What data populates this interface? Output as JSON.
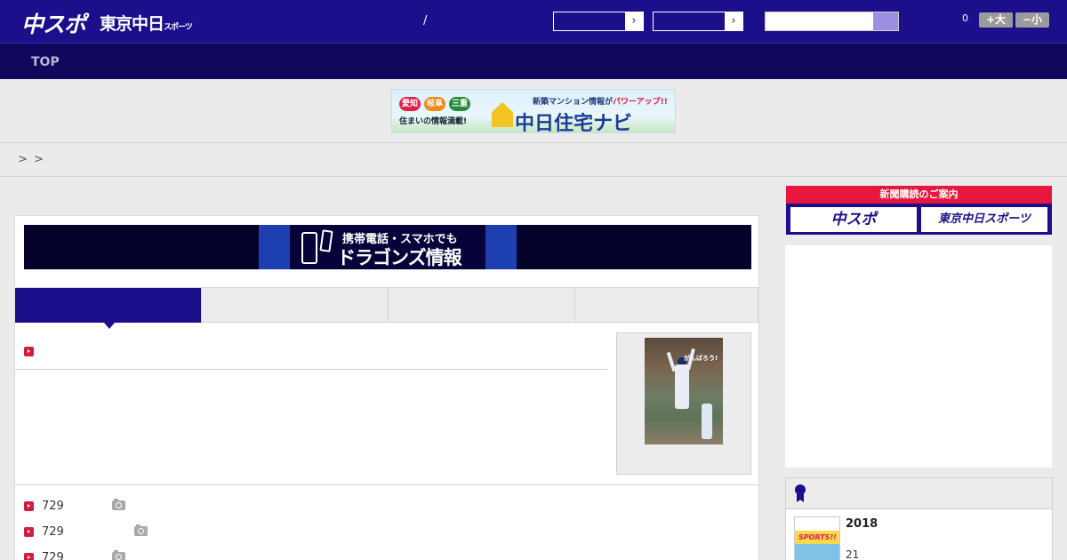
{
  "header": {
    "logo_chuspo": "中スポ",
    "logo_tokyo": "東京中日",
    "logo_tokyo_small": "スポーツ",
    "slash": "/",
    "select1_arrow": "›",
    "select2_arrow": "›",
    "font_count": "0",
    "font_large": "+大",
    "font_small": "−小"
  },
  "nav": {
    "top": "TOP"
  },
  "ad_banner": {
    "chips": [
      "愛知",
      "岐阜",
      "三重"
    ],
    "tagline": "住まいの情報満載!",
    "copy": "新築マンション情報が",
    "copy_em": "パワーアップ!!",
    "brand_a": "中日",
    "brand_b": "住宅ナビ"
  },
  "breadcrumb": {
    "sep1": ">",
    "sep2": ">"
  },
  "dragons_banner": {
    "line1": "携帯電話・スマホでも",
    "line2": "ドラゴンズ情報"
  },
  "photo": {
    "sign": "がんばろう!"
  },
  "news": [
    {
      "num": "729"
    },
    {
      "num": "729"
    },
    {
      "num": "729"
    }
  ],
  "sidebar": {
    "subs_title": "新聞購読のご案内",
    "subs_btn1": "中スポ",
    "subs_btn2": "東京中日スポーツ",
    "rank_year": "2018",
    "rank_date": "21",
    "rank_thumb": "SPORTS!!"
  },
  "colors": {
    "brand": "#1c0f8c",
    "nav": "#11075c",
    "accent": "#e8173f"
  }
}
